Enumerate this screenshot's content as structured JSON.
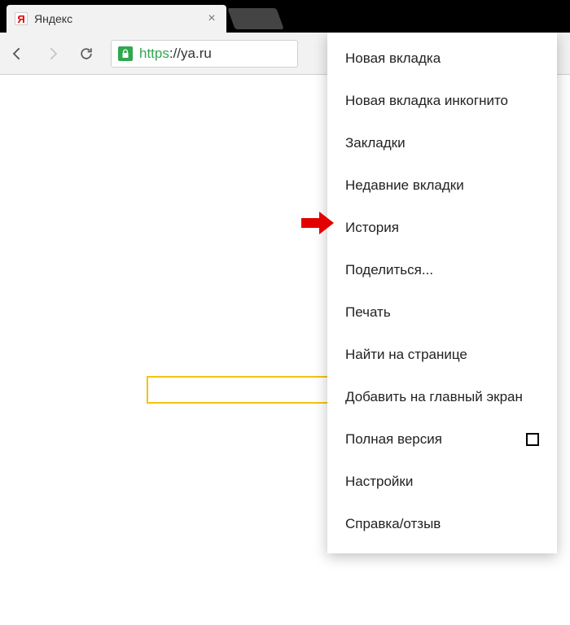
{
  "tab": {
    "favicon_letter": "Я",
    "title": "Яндекс",
    "close": "×"
  },
  "url": {
    "protocol": "https",
    "rest": "://ya.ru"
  },
  "menu": {
    "items": [
      {
        "label": "Новая вкладка"
      },
      {
        "label": "Новая вкладка инкогнито"
      },
      {
        "label": "Закладки"
      },
      {
        "label": "Недавние вкладки"
      },
      {
        "label": "История"
      },
      {
        "label": "Поделиться..."
      },
      {
        "label": "Печать"
      },
      {
        "label": "Найти на странице"
      },
      {
        "label": "Добавить на главный экран"
      },
      {
        "label": "Полная версия",
        "checkbox": true
      },
      {
        "label": "Настройки"
      },
      {
        "label": "Справка/отзыв"
      }
    ]
  },
  "highlight_index": 4
}
